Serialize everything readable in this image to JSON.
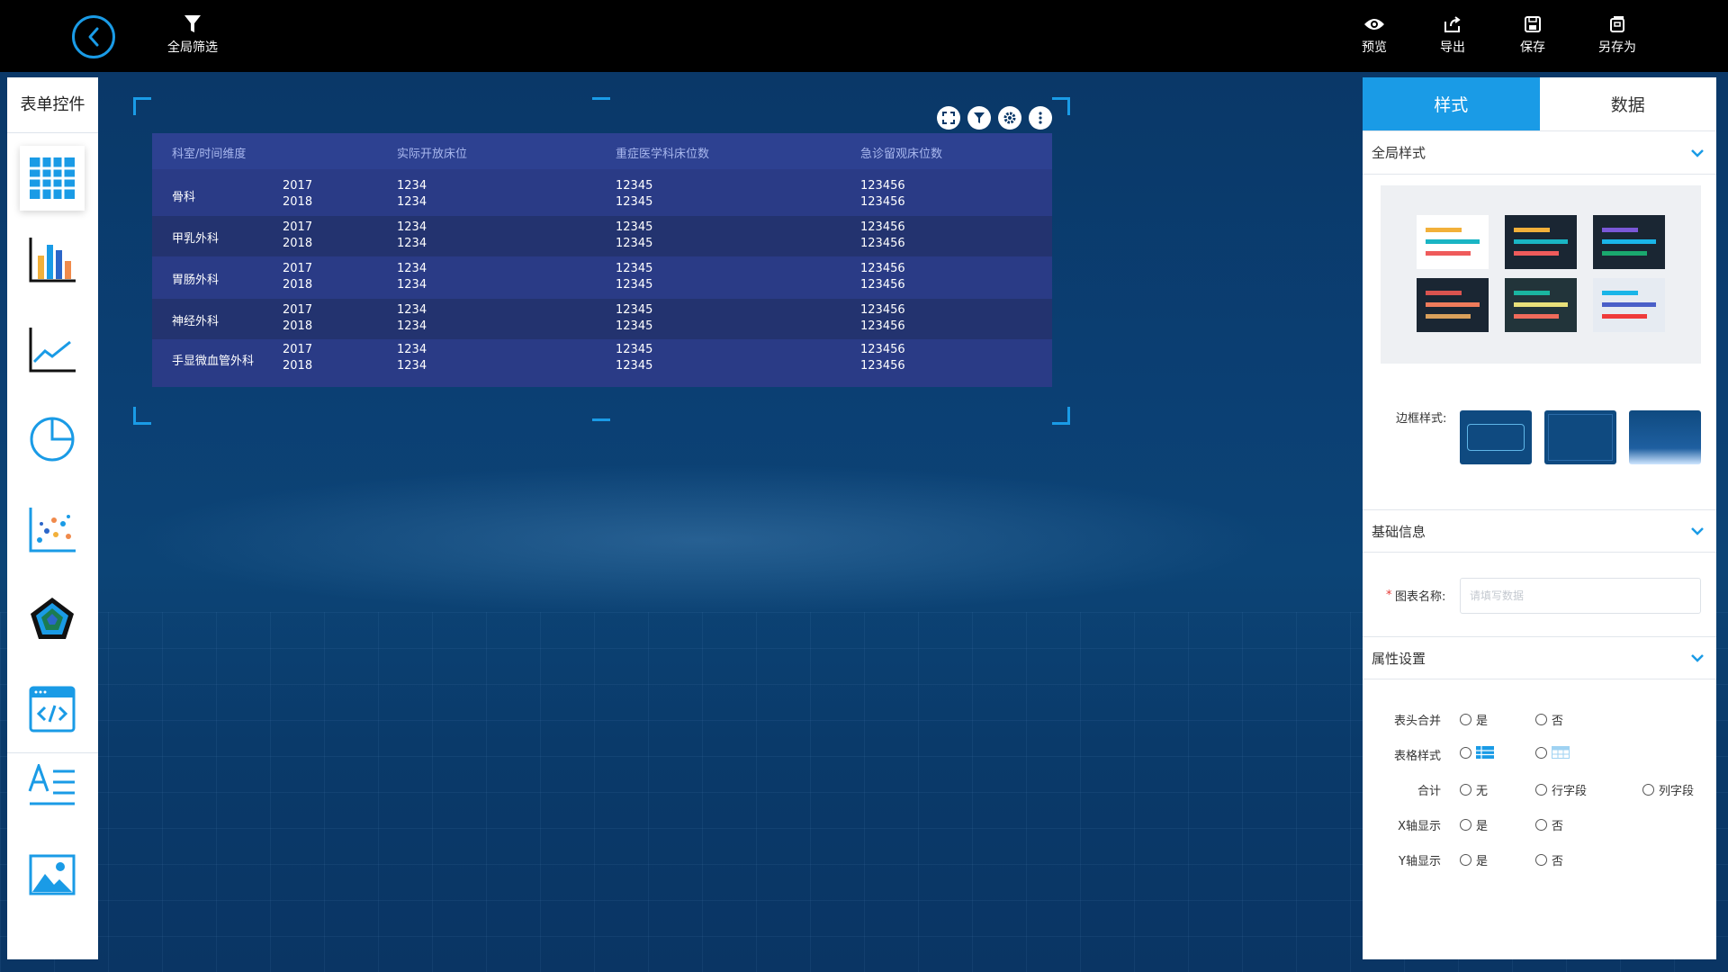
{
  "toolbar": {
    "global_filter": "全局筛选",
    "preview": "预览",
    "export": "导出",
    "save": "保存",
    "save_as": "另存为"
  },
  "left_panel": {
    "title": "表单控件",
    "items": [
      "table-icon",
      "bar-chart-icon",
      "line-chart-icon",
      "pie-chart-icon",
      "scatter-chart-icon",
      "radar-chart-icon",
      "code-icon",
      "text-icon",
      "image-icon"
    ]
  },
  "table": {
    "headers": [
      "科室/时间维度",
      "实际开放床位",
      "重症医学科床位数",
      "急诊留观床位数"
    ],
    "rows": [
      {
        "dept": "骨科",
        "years": [
          "2017",
          "2018"
        ],
        "beds": [
          "1234",
          "1234"
        ],
        "icu": [
          "12345",
          "12345"
        ],
        "er": [
          "123456",
          "123456"
        ]
      },
      {
        "dept": "甲乳外科",
        "years": [
          "2017",
          "2018"
        ],
        "beds": [
          "1234",
          "1234"
        ],
        "icu": [
          "12345",
          "12345"
        ],
        "er": [
          "123456",
          "123456"
        ]
      },
      {
        "dept": "胃肠外科",
        "years": [
          "2017",
          "2018"
        ],
        "beds": [
          "1234",
          "1234"
        ],
        "icu": [
          "12345",
          "12345"
        ],
        "er": [
          "123456",
          "123456"
        ]
      },
      {
        "dept": "神经外科",
        "years": [
          "2017",
          "2018"
        ],
        "beds": [
          "1234",
          "1234"
        ],
        "icu": [
          "12345",
          "12345"
        ],
        "er": [
          "123456",
          "123456"
        ]
      },
      {
        "dept": "手显微血管外科",
        "years": [
          "2017",
          "2018"
        ],
        "beds": [
          "1234",
          "1234"
        ],
        "icu": [
          "12345",
          "12345"
        ],
        "er": [
          "123456",
          "123456"
        ]
      }
    ]
  },
  "right_panel": {
    "tabs": [
      "样式",
      "数据"
    ],
    "sections": {
      "global_style": "全局样式",
      "basic_info": "基础信息",
      "attr_settings": "属性设置"
    },
    "border_style_label": "边框样式:",
    "chart_name_label": "图表名称:",
    "chart_name_required": "*",
    "chart_name_placeholder": "请填写数据",
    "options": {
      "header_merge": {
        "label": "表头合并",
        "choices": [
          "是",
          "否"
        ]
      },
      "table_style": {
        "label": "表格样式"
      },
      "total": {
        "label": "合计",
        "choices": [
          "无",
          "行字段",
          "列字段"
        ]
      },
      "x_axis": {
        "label": "X轴显示",
        "choices": [
          "是",
          "否"
        ]
      },
      "y_axis": {
        "label": "Y轴显示",
        "choices": [
          "是",
          "否"
        ]
      }
    }
  },
  "colors": {
    "accent": "#1a9be6",
    "table_bg": "#2a3b86",
    "topbar": "#000000"
  }
}
